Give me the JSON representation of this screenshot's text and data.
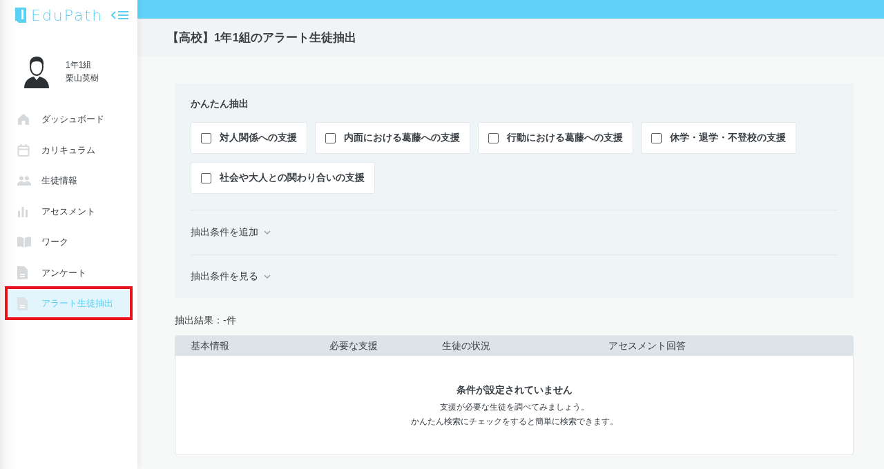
{
  "app": {
    "logo": "EduPath"
  },
  "user": {
    "class": "1年1組",
    "name": "栗山英樹"
  },
  "nav": [
    {
      "label": "ダッシュボード",
      "selected": false,
      "marked": false
    },
    {
      "label": "カリキュラム",
      "selected": false,
      "marked": false
    },
    {
      "label": "生徒情報",
      "selected": false,
      "marked": false
    },
    {
      "label": "アセスメント",
      "selected": false,
      "marked": false
    },
    {
      "label": "ワーク",
      "selected": false,
      "marked": false
    },
    {
      "label": "アンケート",
      "selected": false,
      "marked": false
    },
    {
      "label": "アラート生徒抽出",
      "selected": true,
      "marked": true
    }
  ],
  "header": {
    "title": "【高校】1年1組のアラート生徒抽出"
  },
  "quick_filter": {
    "title": "かんたん抽出",
    "options": [
      {
        "label": "対人関係への支援",
        "checked": false
      },
      {
        "label": "内面における葛藤への支援",
        "checked": false
      },
      {
        "label": "行動における葛藤への支援",
        "checked": false
      },
      {
        "label": "休学・退学・不登校の支援",
        "checked": false
      },
      {
        "label": "社会や大人との関わり合いの支援",
        "checked": false
      }
    ]
  },
  "sections": [
    {
      "label": "抽出条件を追加",
      "expanded": false
    },
    {
      "label": "抽出条件を見る",
      "expanded": false
    }
  ],
  "result": {
    "count_label": "抽出結果：-件"
  },
  "table": {
    "columns": [
      "基本情報",
      "必要な支援",
      "生徒の状況",
      "アセスメント回答"
    ],
    "empty": {
      "title": "条件が設定されていません",
      "lines": [
        "支援が必要な生徒を調べてみましょう。",
        "かんたん検索にチェックをすると簡単に検索できます。"
      ]
    }
  }
}
